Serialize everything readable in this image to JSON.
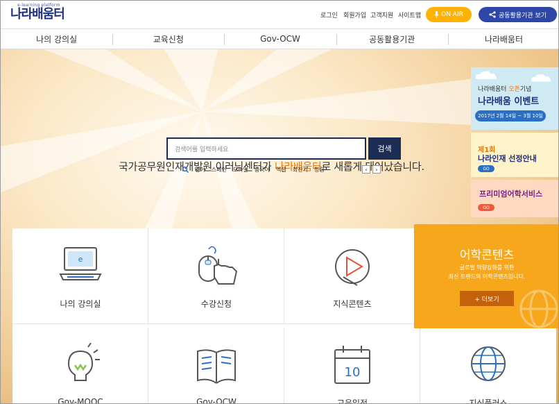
{
  "header": {
    "logo_sub": "e-learning platform",
    "logo": "나라배움터",
    "util_links": [
      "로그인",
      "회원가입",
      "고객지원",
      "사이트맵"
    ],
    "onair": "ON AIR",
    "share": "공동활용기관 보기"
  },
  "nav": [
    "나의 강의실",
    "교육신청",
    "Gov-OCW",
    "공동활용기관",
    "나라배움터"
  ],
  "hero": {
    "headline_pre": "국가공무원인재개발원 이러닝센터가 ",
    "headline_hl": "나라배움터",
    "headline_post": "로 새롭게 태어났습니다.",
    "search_placeholder": "검색어를 입력하세요",
    "search_button": "검색",
    "keywords": [
      "영어",
      "스페인",
      "모바일",
      "중국어",
      "엑셀",
      "최진기",
      "청렴"
    ]
  },
  "banners": {
    "b1_line1_pre": "나라배움터 ",
    "b1_line1_hl": "오픈",
    "b1_line1_post": "기념",
    "b1_line2": "나라배움 이벤트",
    "b1_date": "2017년 2월 14일 ~ 3월 10일",
    "b2_line1": "제1회",
    "b2_line2": "나라인재 선정안내",
    "b2_go": "GO",
    "b3_line1": "프리미엄어학서비스",
    "b3_go": "GO"
  },
  "quick_links": [
    "나의 강의실",
    "수강신청",
    "지식콘텐츠",
    "Gov-MOOC",
    "Gov-OCW",
    "교육일정",
    "지식플러스"
  ],
  "calendar_day": "10",
  "promo": {
    "title": "어학콘텐츠",
    "desc1": "글로벌 역량강화를 위한",
    "desc2": "최신 트렌드의 어학콘텐츠입니다.",
    "button": "+ 더보기"
  },
  "colors": {
    "brand": "#1d2f7e",
    "accent": "#f7a71c",
    "onair": "#ffb300",
    "share": "#2d47a8"
  }
}
